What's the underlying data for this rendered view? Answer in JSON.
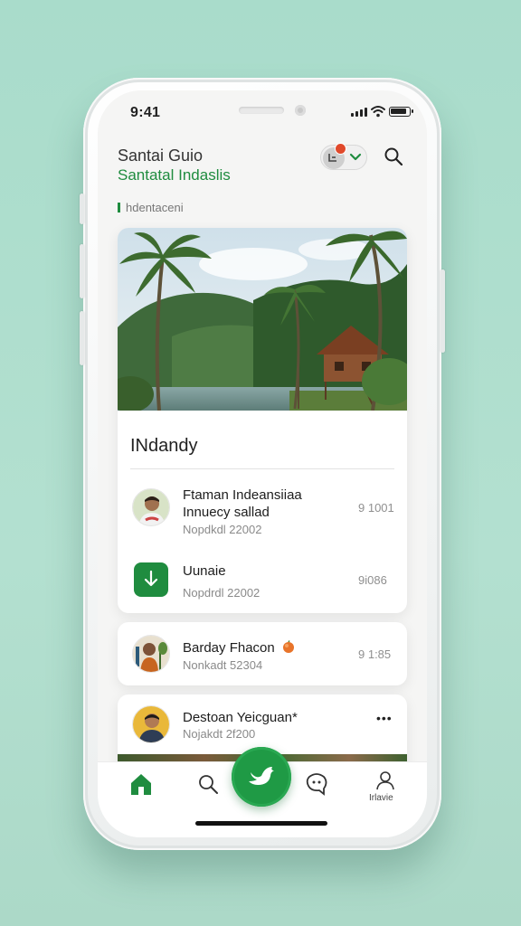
{
  "status_bar": {
    "time": "9:41"
  },
  "header": {
    "title": "Santai Guio",
    "subtitle": "Santatal Indaslis",
    "toggle_icon": "toggle-switch-icon",
    "search_icon": "search-icon"
  },
  "section": {
    "label": "hdentaceni"
  },
  "featured_card": {
    "image": "tropical-lake-house-photo",
    "title": "INdandy",
    "items": [
      {
        "title_line1": "Ftaman Indeansiiaa",
        "title_line2": "Innuecy sallad",
        "subtitle": "Nopdkdl 22002",
        "meta": "9 1001",
        "avatar": "person-avatar"
      },
      {
        "title": "Uunaie",
        "subtitle": "Nopdrdl 22002",
        "meta": "9i086",
        "icon": "download-icon"
      }
    ]
  },
  "list": [
    {
      "title": "Barday Fhacon",
      "emoji": "orange-fruit-icon",
      "subtitle": "Nonkadt 52304",
      "meta": "9 1:85",
      "avatar": "person-with-plant-avatar"
    },
    {
      "title": "Destoan Yeicguan*",
      "subtitle": "Nojakdt 2f200",
      "meta": "•••",
      "avatar": "man-avatar"
    }
  ],
  "tab_bar": {
    "items": [
      {
        "name": "home",
        "icon": "home-icon"
      },
      {
        "name": "search",
        "icon": "search-icon"
      },
      {
        "name": "fab",
        "icon": "bird-icon"
      },
      {
        "name": "chat",
        "icon": "chat-face-icon"
      },
      {
        "name": "profile",
        "icon": "profile-icon",
        "label": "Irlavie"
      }
    ]
  },
  "colors": {
    "accent": "#1f8c3f",
    "background": "#acdcca",
    "notification": "#e0492b"
  }
}
